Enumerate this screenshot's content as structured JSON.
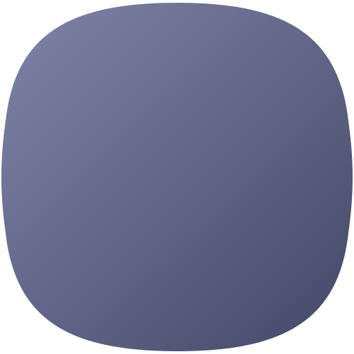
{
  "app_icon": {
    "icon_name": "menu-lines-icon",
    "colors": {
      "background_gradient_start": "#8084A8",
      "background_gradient_end": "#434767",
      "line_gradient_start": "#ECEEFF",
      "line_gradient_end": "#D3D7FF"
    },
    "lines": [
      {
        "name": "menu-line-top"
      },
      {
        "name": "menu-line-middle"
      },
      {
        "name": "menu-line-bottom"
      }
    ]
  }
}
